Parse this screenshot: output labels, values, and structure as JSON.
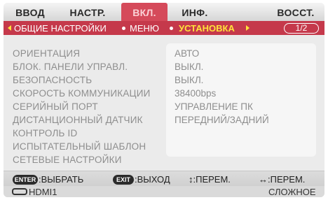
{
  "tabs": [
    {
      "label": "ВВОД"
    },
    {
      "label": "НАСТР."
    },
    {
      "label": "ВКЛ."
    },
    {
      "label": "ИНФ."
    },
    {
      "label": "ВОССТ."
    }
  ],
  "breadcrumb": {
    "item1": "ОБЩИЕ НАСТРОЙКИ",
    "item2": "МЕНЮ",
    "current": "УСТАНОВКА",
    "page": "1/2"
  },
  "settings": [
    {
      "label": "ОРИЕНТАЦИЯ",
      "value": "АВТО"
    },
    {
      "label": "БЛОК. ПАНЕЛИ УПРАВЛ.",
      "value": "ВЫКЛ."
    },
    {
      "label": "БЕЗОПАСНОСТЬ",
      "value": "ВЫКЛ."
    },
    {
      "label": "СКОРОСТЬ КОММУНИКАЦИИ",
      "value": "38400bps"
    },
    {
      "label": "СЕРИЙНЫЙ ПОРТ",
      "value": "УПРАВЛЕНИЕ ПК"
    },
    {
      "label": "ДИСТАНЦИОННЫЙ ДАТЧИК",
      "value": "ПЕРЕДНИЙ/ЗАДНИЙ"
    },
    {
      "label": "КОНТРОЛЬ ID",
      "value": ""
    },
    {
      "label": "ИСПЫТАТЕЛЬНЫЙ ШАБЛОН",
      "value": ""
    },
    {
      "label": "СЕТЕВЫЕ НАСТРОЙКИ",
      "value": ""
    }
  ],
  "help": {
    "enter_key": "ENTER",
    "enter_text": ":ВЫБРАТЬ",
    "exit_key": "EXIT",
    "exit_text": ":ВЫХОД",
    "updown_text": "↕:ПЕРЕМ.",
    "leftright_text": "↔:ПЕРЕМ."
  },
  "status": {
    "input": "HDMI1",
    "mode": "СЛОЖНОЕ"
  },
  "colors": {
    "accent": "#c5394b",
    "active_tab": "#d54a5a",
    "current_crumb": "#ffe23a"
  }
}
